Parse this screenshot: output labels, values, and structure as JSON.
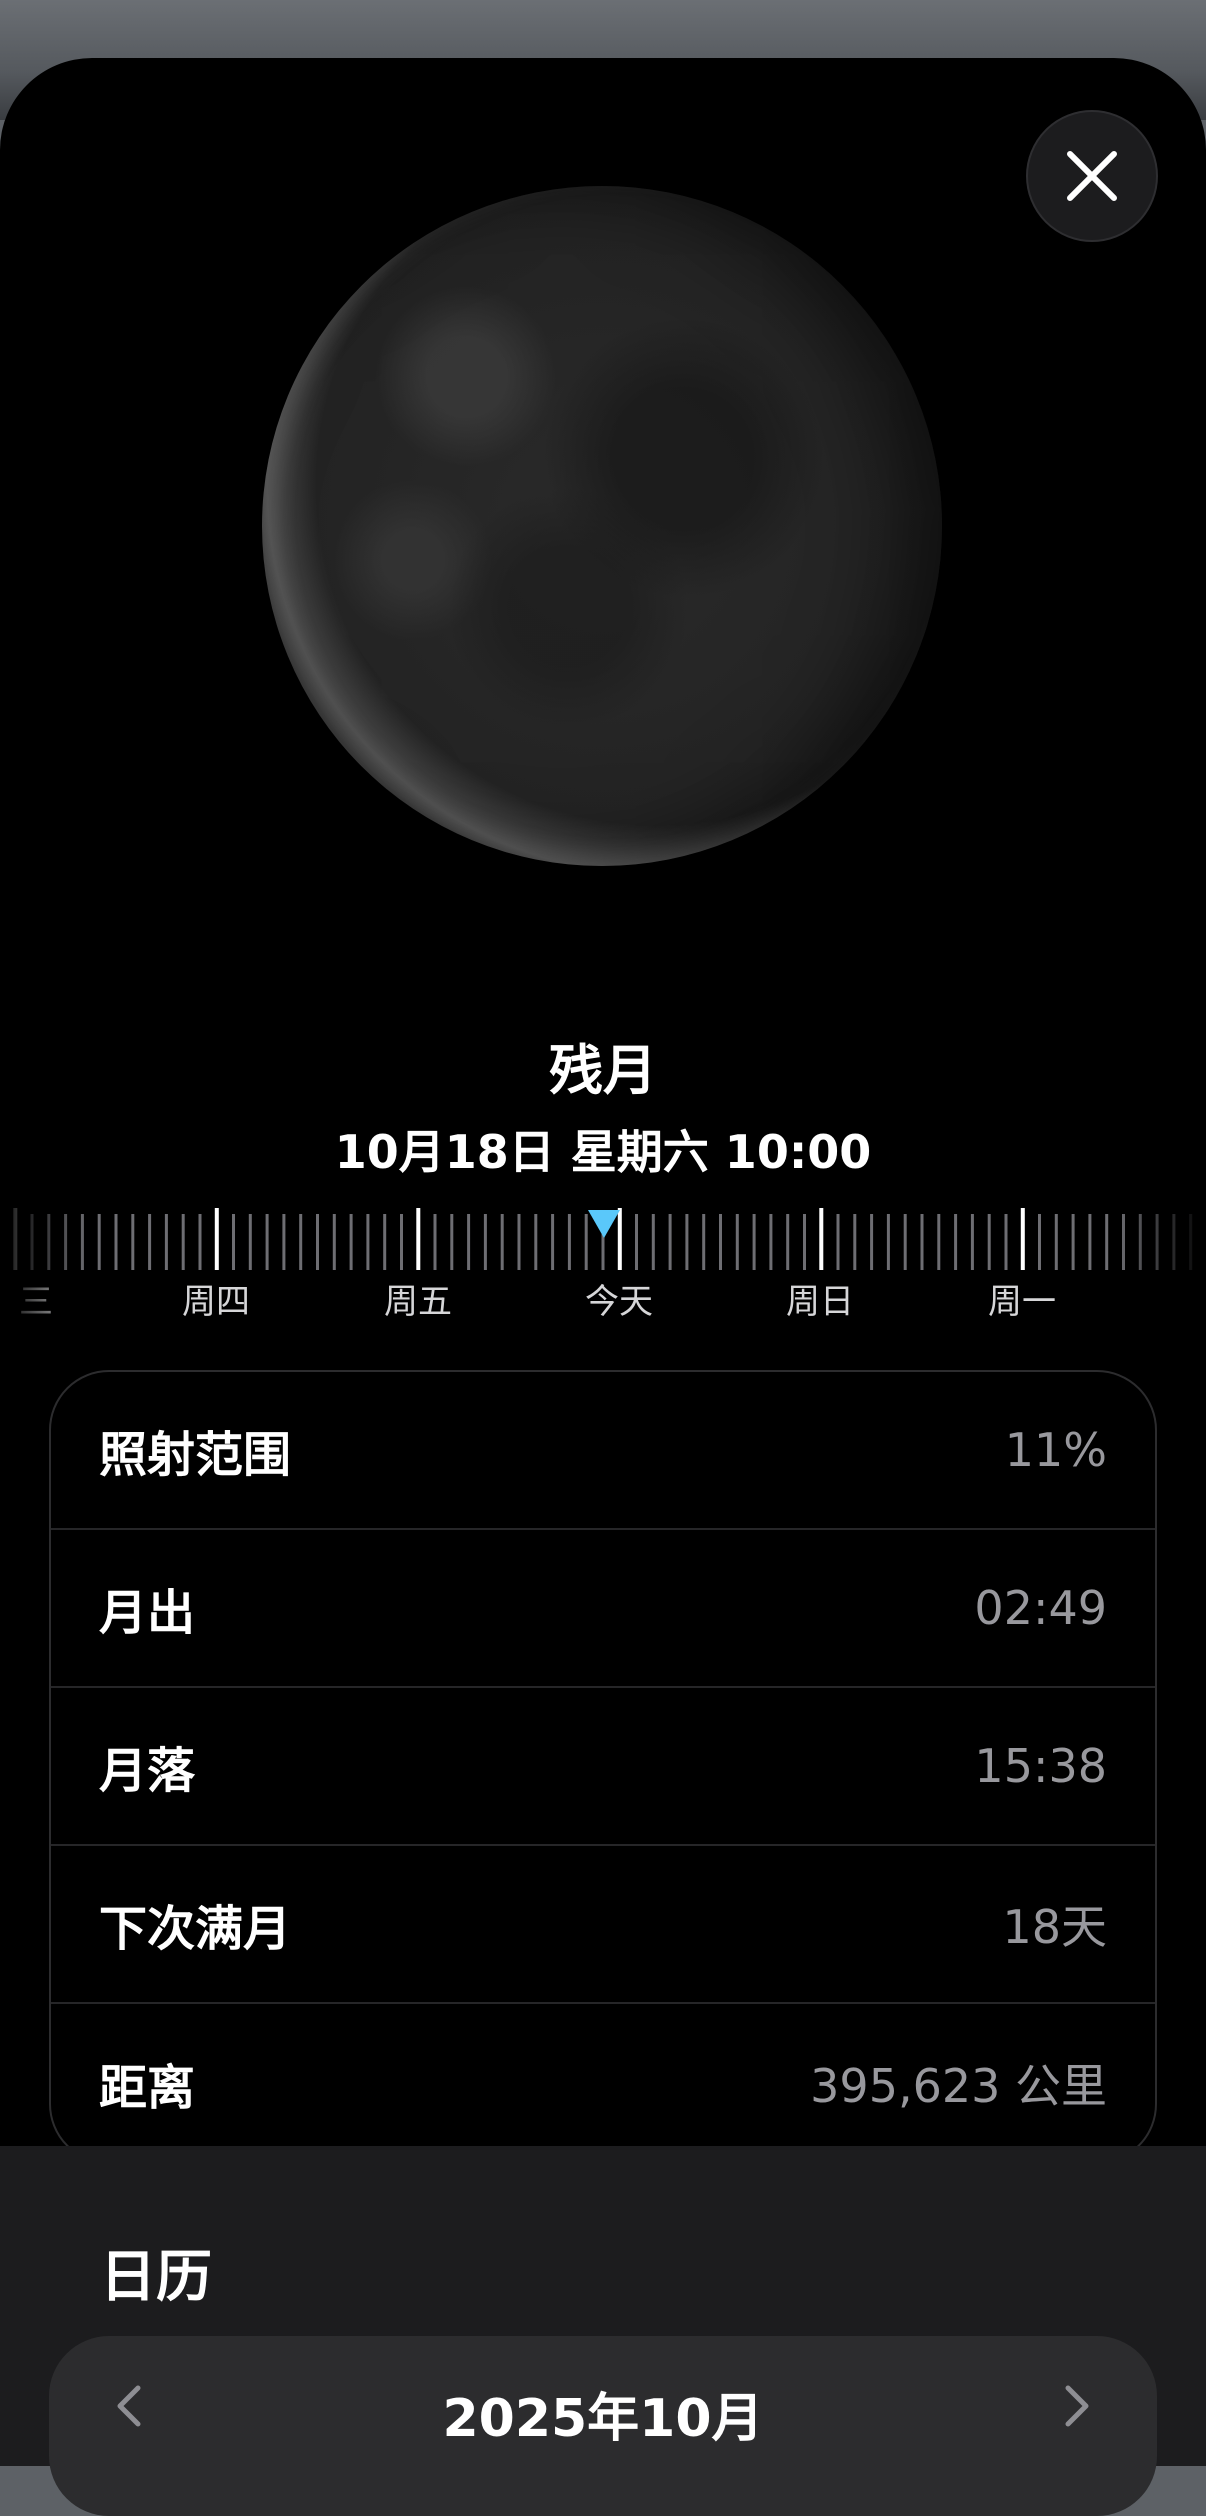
{
  "moon": {
    "phase_name": "残月",
    "date_time": "10月18日 星期六 10:00"
  },
  "timeline": {
    "days": [
      "三",
      "周四",
      "周五",
      "今天",
      "周日",
      "周一"
    ],
    "marker_color": "#5ac8fa"
  },
  "info": {
    "rows": [
      {
        "label": "照射范围",
        "value": "11%"
      },
      {
        "label": "月出",
        "value": "02:49"
      },
      {
        "label": "月落",
        "value": "15:38"
      },
      {
        "label": "下次满月",
        "value": "18天"
      },
      {
        "label": "距离",
        "value": "395,623 公里"
      }
    ]
  },
  "calendar": {
    "title": "日历",
    "month": "2025年10月"
  },
  "icons": {
    "close": "close-icon",
    "prev": "chevron-left-icon",
    "next": "chevron-right-icon"
  }
}
